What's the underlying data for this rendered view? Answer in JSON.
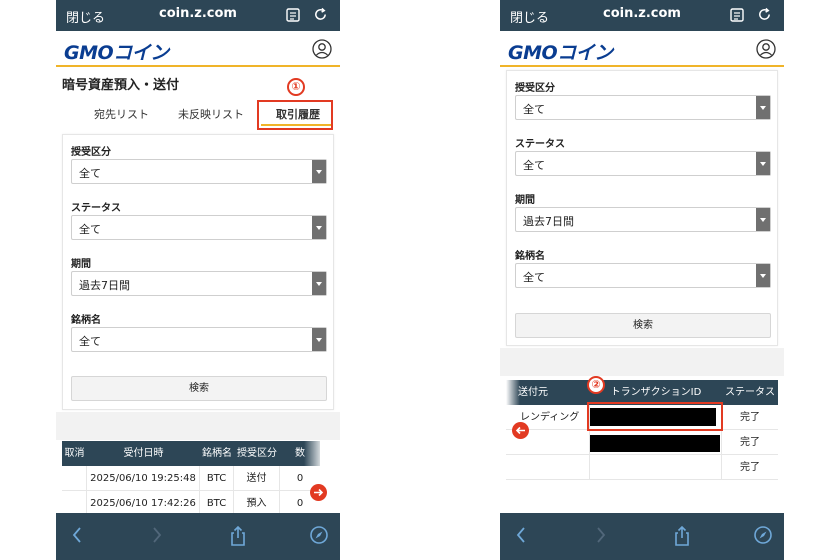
{
  "browser": {
    "close_label": "閉じる",
    "url": "coin.z.com"
  },
  "logo": {
    "gmo": "GMO",
    "coin": "コイン"
  },
  "page_title": "暗号資産預入・送付",
  "tabs": [
    {
      "label": "宛先リスト"
    },
    {
      "label": "未反映リスト"
    },
    {
      "label": "取引履歴"
    }
  ],
  "markers": {
    "first": "①",
    "second": "②"
  },
  "filters": {
    "direction": {
      "label": "授受区分",
      "value": "全て"
    },
    "status": {
      "label": "ステータス",
      "value": "全て"
    },
    "period": {
      "label": "期間",
      "value": "過去7日間"
    },
    "symbol": {
      "label": "銘柄名",
      "value": "全て"
    },
    "search_label": "検索"
  },
  "history_table_left": {
    "headers": [
      "取消",
      "受付日時",
      "銘柄名",
      "授受区分",
      "数"
    ],
    "rows": [
      [
        "",
        "2025/06/10 19:25:48",
        "BTC",
        "送付",
        "0"
      ],
      [
        "",
        "2025/06/10 17:42:26",
        "BTC",
        "預入",
        "0"
      ]
    ]
  },
  "history_table_right": {
    "headers": [
      "送付元",
      "トランザクションID",
      "ステータス"
    ],
    "rows": [
      [
        "レンディング",
        "",
        "完了"
      ],
      [
        "",
        "",
        "完了"
      ],
      [
        "",
        "",
        "完了"
      ]
    ]
  },
  "colors": {
    "navy": "#2d4656",
    "accent_yellow": "#f0b429",
    "highlight_red": "#e23a22",
    "logo_blue": "#0a3d91"
  }
}
